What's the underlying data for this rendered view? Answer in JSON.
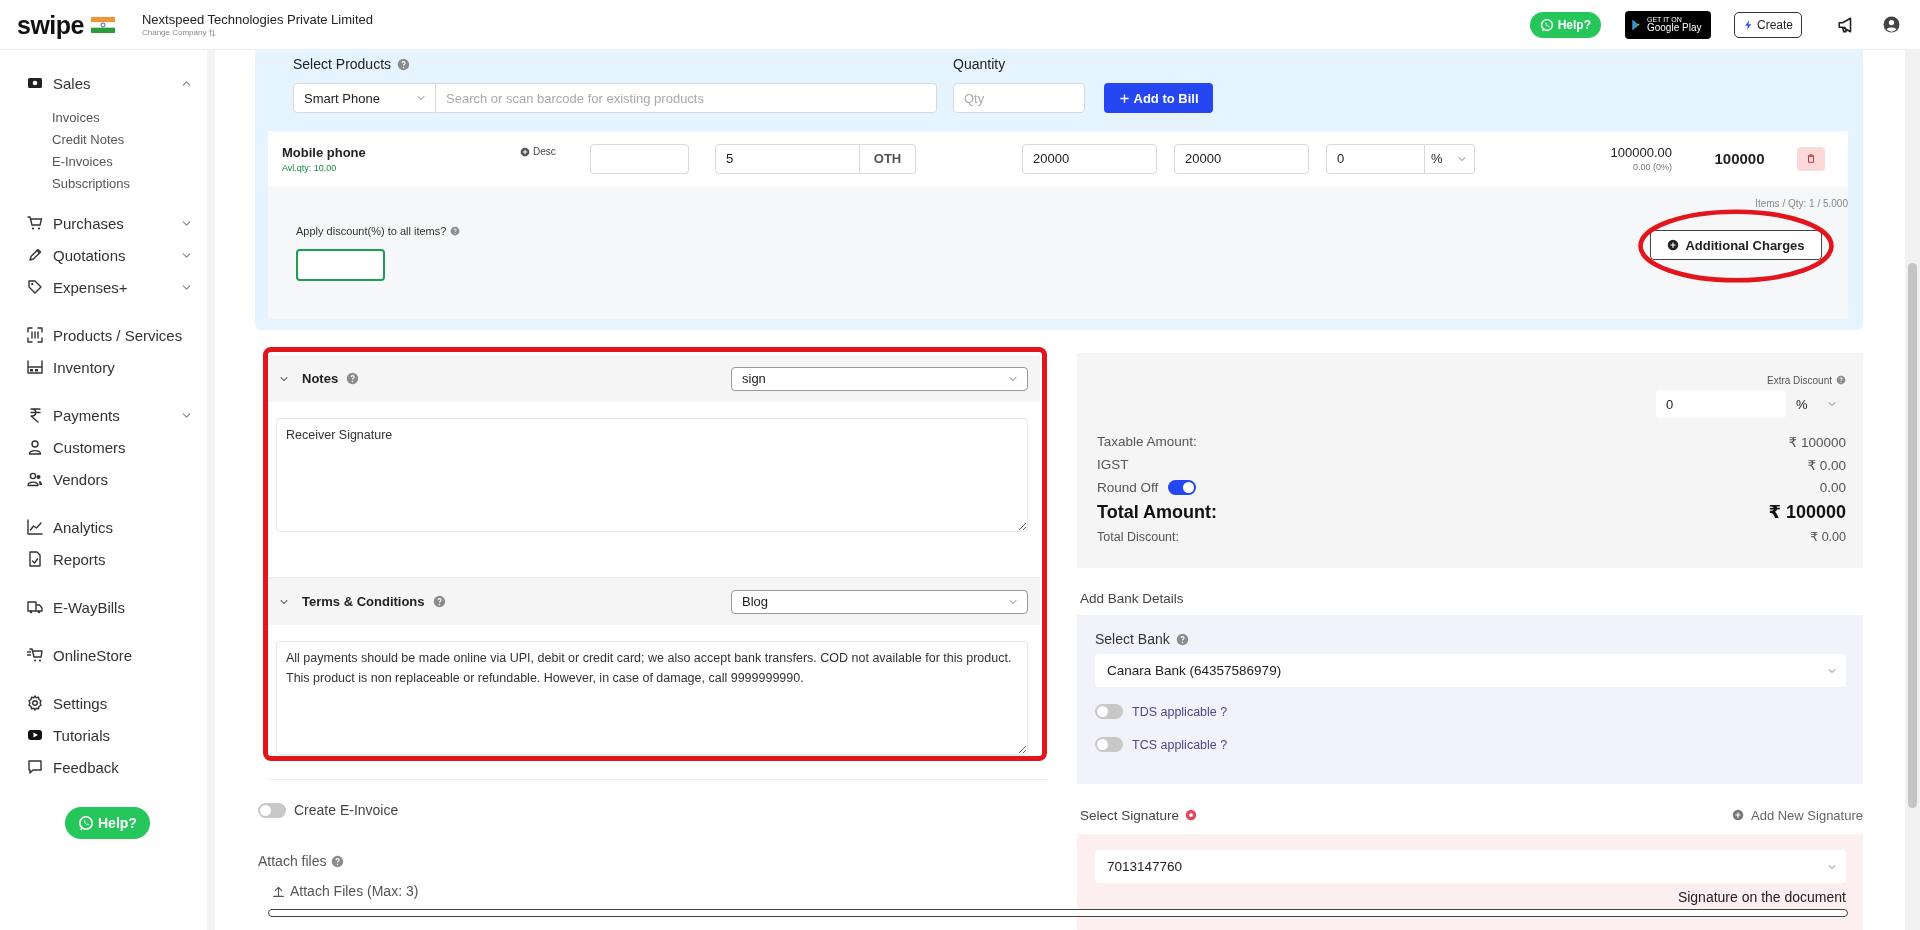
{
  "header": {
    "logo": "swipe",
    "company": "Nextspeed Technologies Private Limited",
    "change_company": "Change Company",
    "help_button": "Help?",
    "store_badge": {
      "small": "GET IT ON",
      "large": "Google Play"
    },
    "create_button": "Create"
  },
  "sidebar": {
    "groups": [
      [
        {
          "label": "Sales",
          "expanded": true,
          "children": [
            {
              "label": "Invoices"
            },
            {
              "label": "Credit Notes"
            },
            {
              "label": "E-Invoices"
            },
            {
              "label": "Subscriptions"
            }
          ]
        },
        {
          "label": "Purchases",
          "expanded": false
        },
        {
          "label": "Quotations",
          "expanded": false
        },
        {
          "label": "Expenses+",
          "expanded": false
        }
      ],
      [
        {
          "label": "Products / Services"
        },
        {
          "label": "Inventory"
        }
      ],
      [
        {
          "label": "Payments",
          "expanded": false
        },
        {
          "label": "Customers"
        },
        {
          "label": "Vendors"
        }
      ],
      [
        {
          "label": "Analytics"
        },
        {
          "label": "Reports"
        }
      ],
      [
        {
          "label": "E-WayBills"
        }
      ],
      [
        {
          "label": "OnlineStore"
        }
      ],
      [
        {
          "label": "Settings"
        },
        {
          "label": "Tutorials"
        },
        {
          "label": "Feedback"
        }
      ]
    ],
    "help_button": "Help?"
  },
  "products": {
    "select_label": "Select Products",
    "category": "Smart Phone",
    "search_placeholder": "Search or scan barcode for existing products",
    "quantity_label": "Quantity",
    "quantity_placeholder": "Qty",
    "add_button": "Add to Bill"
  },
  "line_items": [
    {
      "name": "Mobile phone",
      "stock": "Avl.qty: 10.00",
      "desc_button": "Desc",
      "qty": "5",
      "unit": "OTH",
      "unit_price": "20000",
      "price_with_tax": "20000",
      "discount": "0",
      "discount_type": "%",
      "net_amount": "100000.00",
      "tax": "0.00 (0%)",
      "total": "100000"
    }
  ],
  "discount_all": {
    "label": "Apply discount(%) to all items?"
  },
  "items_summary": "Items / Qty: 1 / 5.000",
  "additional_charges_button": "Additional Charges",
  "notes": {
    "title": "Notes",
    "expanded": true,
    "template": "sign",
    "text": "Receiver Signature"
  },
  "terms": {
    "title": "Terms & Conditions",
    "expanded": true,
    "template": "Blog",
    "text": "All payments should be made online via UPI, debit or credit card; we also accept bank transfers. COD not available for this product.\nThis product is non replaceable or refundable. However, in case of damage, call 9999999990."
  },
  "e_invoice": {
    "label": "Create E-Invoice",
    "on": false
  },
  "attachments": {
    "label": "Attach files",
    "button": "Attach Files (Max: 3)"
  },
  "summary": {
    "extra_discount_label": "Extra Discount",
    "extra_discount": "0",
    "extra_discount_type": "%",
    "rows": [
      {
        "kind": "plain",
        "label": "Taxable Amount:",
        "value": "₹ 100000"
      },
      {
        "kind": "plain",
        "label": "IGST",
        "value": "₹ 0.00"
      },
      {
        "kind": "toggle",
        "label": "Round Off",
        "on": true,
        "value": "0.00"
      },
      {
        "kind": "total",
        "label": "Total Amount:",
        "value": "₹ 100000"
      },
      {
        "kind": "minor",
        "label": "Total Discount:",
        "value": "₹ 0.00"
      }
    ]
  },
  "bank": {
    "title": "Add Bank Details",
    "select_label": "Select Bank",
    "selected_bank": "Canara Bank (64357586979)",
    "toggles": [
      {
        "label": "TDS applicable ?",
        "on": false
      },
      {
        "label": "TCS applicable ?",
        "on": false
      }
    ]
  },
  "signature": {
    "title": "Select Signature",
    "add_link": "Add New Signature",
    "selected": "7013147760",
    "caption": "Signature on the document"
  }
}
